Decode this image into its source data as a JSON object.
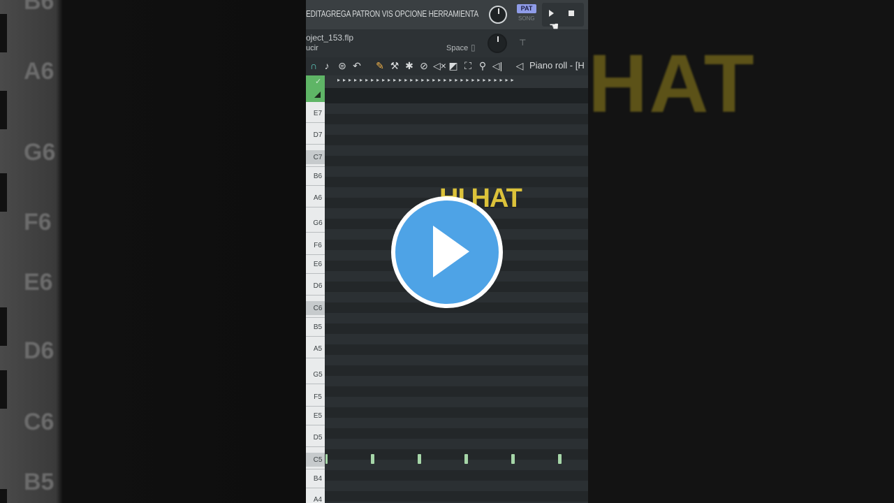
{
  "menu": {
    "items_text": "EDITAGREGA PATRON VIS OPCIONE HERRAMIENTA",
    "pat_badge": "PAT",
    "song_label": "SONG"
  },
  "hint": {
    "filename": "oject_153.flp",
    "sub": "ucir",
    "space_label": "Space"
  },
  "pianoroll": {
    "title": "Piano roll - [H"
  },
  "timeline": {
    "dots": "▸▸▸▸▸▸▸▸▸▸▸▸▸▸▸▸▸▸▸▸▸▸▸▸▸▸▸▸▸▸▸▸"
  },
  "keys": [
    {
      "label": "E7"
    },
    {
      "label": "D7"
    },
    {
      "label": "C7"
    },
    {
      "label": "B6"
    },
    {
      "label": "A6"
    },
    {
      "label": "G6"
    },
    {
      "label": "F6"
    },
    {
      "label": "E6"
    },
    {
      "label": "D6"
    },
    {
      "label": "C6"
    },
    {
      "label": "B5"
    },
    {
      "label": "A5"
    },
    {
      "label": "G5"
    },
    {
      "label": "F5"
    },
    {
      "label": "E5"
    },
    {
      "label": "D5"
    },
    {
      "label": "C5"
    },
    {
      "label": "B4"
    },
    {
      "label": "A4"
    }
  ],
  "background_keys": [
    "B6",
    "A6",
    "G6",
    "F6",
    "E6",
    "D6",
    "C6",
    "B5"
  ],
  "overlay": {
    "title": "HI HAT",
    "bg_title": "HAT"
  },
  "colors": {
    "accent_blue": "#4ea3e6",
    "hihat_yellow": "#dcc23a",
    "note_green": "#a6d6a8",
    "corner_green": "#5fb566"
  }
}
